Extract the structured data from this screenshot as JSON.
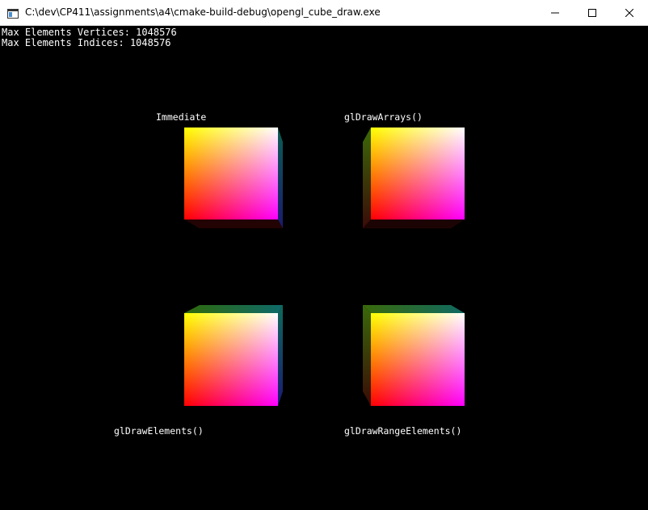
{
  "window": {
    "title": "C:\\dev\\CP411\\assignments\\a4\\cmake-build-debug\\opengl_cube_draw.exe",
    "controls": [
      "minimize",
      "maximize",
      "close"
    ]
  },
  "stats": {
    "line1": "Max Elements Vertices: 1048576",
    "line2": "Max Elements Indices: 1048576"
  },
  "panels": [
    {
      "label": "Immediate"
    },
    {
      "label": "glDrawArrays()"
    },
    {
      "label": "glDrawElements()"
    },
    {
      "label": "glDrawRangeElements()"
    }
  ],
  "colors": {
    "background": "#000000",
    "text": "#ffffff",
    "cube_face_top_left": "#ffff00",
    "cube_face_top_right": "#ffffff",
    "cube_face_bottom_left": "#ff0000",
    "cube_face_bottom_right": "#ff00ff"
  }
}
